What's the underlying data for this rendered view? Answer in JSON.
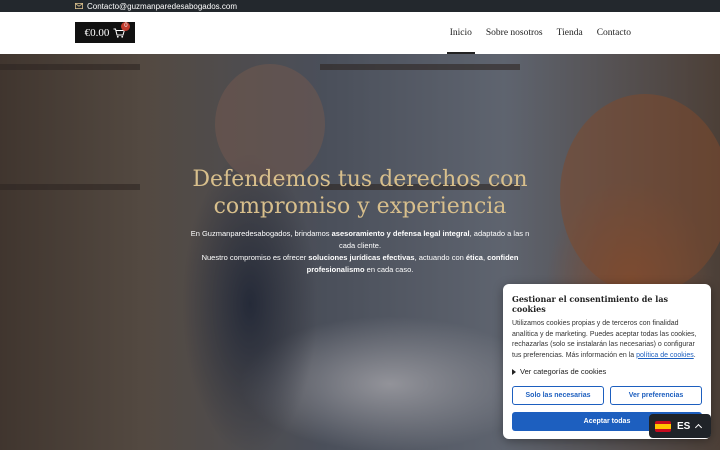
{
  "topbar": {
    "email": "Contacto@guzmanparedesabogados.com",
    "email_icon": "envelope-icon"
  },
  "header": {
    "cart_total": "€0.00",
    "cart_count": "0",
    "cart_icon": "cart-icon",
    "menu": [
      {
        "label": "Inicio",
        "active": true
      },
      {
        "label": "Sobre nosotros",
        "active": false
      },
      {
        "label": "Tienda",
        "active": false
      },
      {
        "label": "Contacto",
        "active": false
      }
    ]
  },
  "hero": {
    "headline_line1": "Defendemos tus derechos con",
    "headline_line2": "compromiso y experiencia",
    "intro_p1_a": "En Guzmanparedesabogados, brindamos ",
    "intro_p1_b": "asesoramiento y defensa legal integral",
    "intro_p1_c": ", adaptado a las n",
    "intro_p1_d": "cada cliente.",
    "intro_p2_a": "Nuestro compromiso es ofrecer ",
    "intro_p2_b": "soluciones jurídicas efectivas",
    "intro_p2_c": ", actuando con ",
    "intro_p2_d": "ética",
    "intro_p2_e": ", ",
    "intro_p2_f": "confiden",
    "intro_p2_g": "profesionalismo",
    "intro_p2_h": " en cada caso."
  },
  "consent": {
    "title": "Gestionar el consentimiento de las cookies",
    "body": "Utilizamos cookies propias y de terceros con finalidad analítica y de marketing. Puedes aceptar todas las cookies, rechazarlas (solo se instalarán las necesarias) o configurar tus preferencias. Más información en la ",
    "policy_link": "política de cookies",
    "body_end": ".",
    "categories_label": "Ver categorías de cookies",
    "btn_necessary": "Solo las necesarias",
    "btn_preferences": "Ver preferencias",
    "btn_accept": "Aceptar todas"
  },
  "language": {
    "code": "ES",
    "flag_icon": "spain-flag-icon"
  },
  "colors": {
    "topbar_bg": "#23282d",
    "headline": "#d8bf8c",
    "accent": "#1d5fbf",
    "cart_bg": "#111111"
  }
}
